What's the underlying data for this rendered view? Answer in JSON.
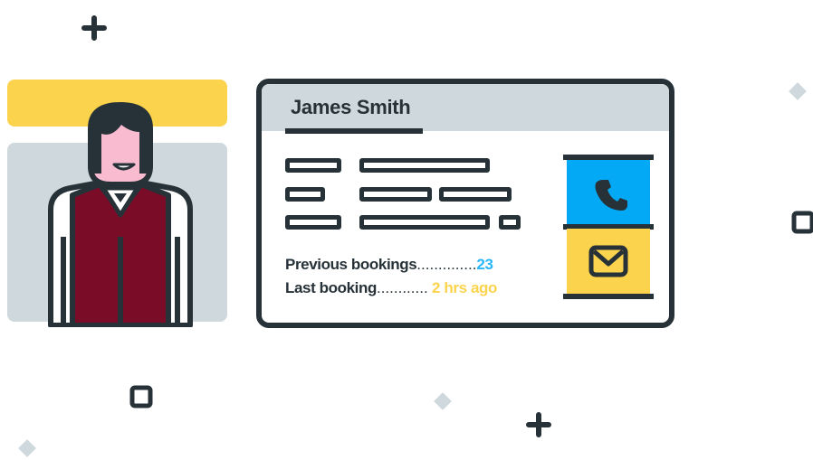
{
  "contact": {
    "name": "James Smith",
    "previous_bookings_label": "Previous bookings",
    "previous_bookings_dots": "..............",
    "previous_bookings_value": "23",
    "last_booking_label": "Last booking",
    "last_booking_dots": "............",
    "last_booking_value": "2 hrs ago"
  },
  "icons": {
    "phone": "phone-icon",
    "mail": "mail-icon",
    "avatar": "person-avatar"
  },
  "colors": {
    "dark": "#263238",
    "accent_yellow": "#FCD34D",
    "accent_blue": "#03A9F4",
    "panel_gray": "#CFD8DC",
    "vest": "#7B0C28",
    "skin": "#F8BBD0"
  }
}
